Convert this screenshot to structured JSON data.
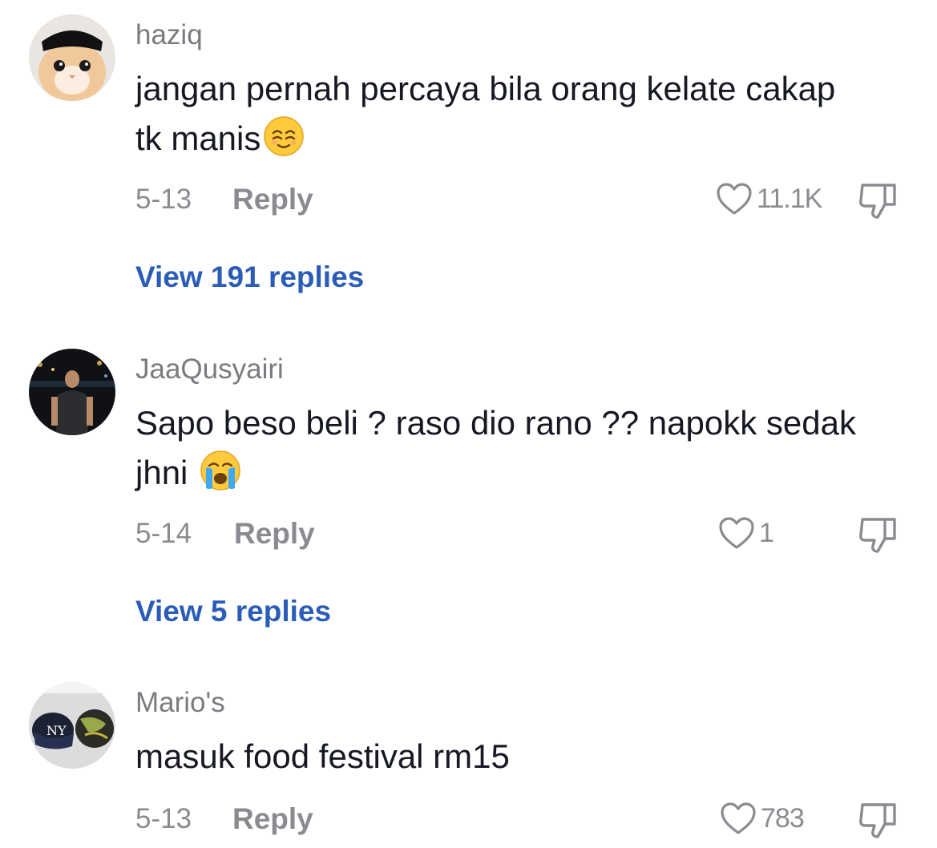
{
  "comments": [
    {
      "username": "haziq",
      "text": "jangan pernah percaya bila orang kelate cakap tk manis",
      "emoji": "relieved-face-emoji",
      "date": "5-13",
      "reply_label": "Reply",
      "likes": "11.1K",
      "view_replies": "View 191 replies"
    },
    {
      "username": "JaaQusyairi",
      "text": "Sapo beso beli ? raso dio rano ?? napokk sedak jhni",
      "emoji": "crying-face-emoji",
      "date": "5-14",
      "reply_label": "Reply",
      "likes": "1",
      "view_replies": "View 5 replies"
    },
    {
      "username": "Mario's",
      "text": "masuk food festival rm15",
      "date": "5-13",
      "reply_label": "Reply",
      "likes": "783"
    }
  ],
  "icons": {
    "like": "heart-outline-icon",
    "dislike": "thumbs-down-icon"
  },
  "colors": {
    "link": "#2b5db8",
    "muted": "#8a8b91",
    "text": "#161823"
  }
}
